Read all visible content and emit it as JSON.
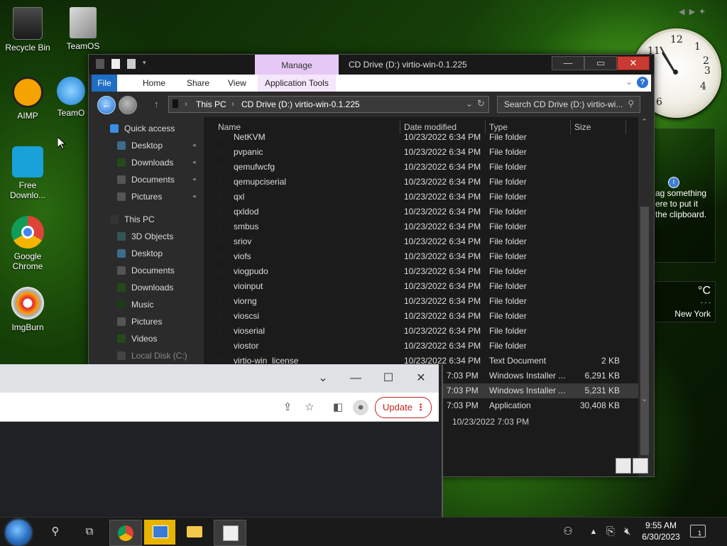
{
  "desktop": {
    "icons": [
      {
        "label": "Recycle Bin",
        "icon": "recycle-bin-icon"
      },
      {
        "label": "TeamOS",
        "icon": "teamos-icon"
      },
      {
        "label": "AIMP",
        "icon": "aimp-icon"
      },
      {
        "label": "TeamO",
        "icon": "internet-explorer-icon"
      },
      {
        "label": "Free Downlo...",
        "icon": "free-download-manager-icon"
      },
      {
        "label": "Google Chrome",
        "icon": "chrome-icon"
      },
      {
        "label": "ImgBurn",
        "icon": "imgburn-icon"
      }
    ],
    "gadgets": {
      "clipboard_text": "ag something ere to put it the clipboard.",
      "weather_unit": "°C",
      "weather_dash": "- - -",
      "weather_city": "New York"
    }
  },
  "explorer": {
    "ribbon_context_tab": "Manage",
    "title": "CD Drive (D:) virtio-win-0.1.225",
    "tabs": [
      "File",
      "Home",
      "Share",
      "View",
      "Application Tools"
    ],
    "address": {
      "crumbs": [
        "This PC",
        "CD Drive (D:) virtio-win-0.1.225"
      ]
    },
    "search_placeholder": "Search CD Drive (D:) virtio-wi...",
    "nav": {
      "quick_access": "Quick access",
      "quick_items": [
        "Desktop",
        "Downloads",
        "Documents",
        "Pictures"
      ],
      "this_pc": "This PC",
      "pc_items": [
        "3D Objects",
        "Desktop",
        "Documents",
        "Downloads",
        "Music",
        "Pictures",
        "Videos",
        "Local Disk (C:)"
      ]
    },
    "columns": {
      "name": "Name",
      "date": "Date modified",
      "type": "Type",
      "size": "Size"
    },
    "files": [
      {
        "name": "NetKVM",
        "date": "10/23/2022 6:34 PM",
        "type": "File folder",
        "size": ""
      },
      {
        "name": "pvpanic",
        "date": "10/23/2022 6:34 PM",
        "type": "File folder",
        "size": ""
      },
      {
        "name": "qemufwcfg",
        "date": "10/23/2022 6:34 PM",
        "type": "File folder",
        "size": ""
      },
      {
        "name": "qemupciserial",
        "date": "10/23/2022 6:34 PM",
        "type": "File folder",
        "size": ""
      },
      {
        "name": "qxl",
        "date": "10/23/2022 6:34 PM",
        "type": "File folder",
        "size": ""
      },
      {
        "name": "qxldod",
        "date": "10/23/2022 6:34 PM",
        "type": "File folder",
        "size": ""
      },
      {
        "name": "smbus",
        "date": "10/23/2022 6:34 PM",
        "type": "File folder",
        "size": ""
      },
      {
        "name": "sriov",
        "date": "10/23/2022 6:34 PM",
        "type": "File folder",
        "size": ""
      },
      {
        "name": "viofs",
        "date": "10/23/2022 6:34 PM",
        "type": "File folder",
        "size": ""
      },
      {
        "name": "viogpudo",
        "date": "10/23/2022 6:34 PM",
        "type": "File folder",
        "size": ""
      },
      {
        "name": "vioinput",
        "date": "10/23/2022 6:34 PM",
        "type": "File folder",
        "size": ""
      },
      {
        "name": "viorng",
        "date": "10/23/2022 6:34 PM",
        "type": "File folder",
        "size": ""
      },
      {
        "name": "vioscsi",
        "date": "10/23/2022 6:34 PM",
        "type": "File folder",
        "size": ""
      },
      {
        "name": "vioserial",
        "date": "10/23/2022 6:34 PM",
        "type": "File folder",
        "size": ""
      },
      {
        "name": "viostor",
        "date": "10/23/2022 6:34 PM",
        "type": "File folder",
        "size": ""
      },
      {
        "name": "virtio-win_license",
        "date": "10/23/2022 6:34 PM",
        "type": "Text Document",
        "size": "2 KB"
      },
      {
        "name": "",
        "date": "7:03 PM",
        "type": "Windows Installer ...",
        "size": "6,291 KB"
      },
      {
        "name": "",
        "date": "7:03 PM",
        "type": "Windows Installer ...",
        "size": "5,231 KB"
      },
      {
        "name": "",
        "date": "7:03 PM",
        "type": "Application",
        "size": "30,408 KB"
      }
    ],
    "details_date": "10/23/2022 7:03 PM"
  },
  "chrome": {
    "update_label": "Update"
  },
  "taskbar": {
    "time": "9:55 AM",
    "date": "6/30/2023",
    "notification_count": "1"
  }
}
